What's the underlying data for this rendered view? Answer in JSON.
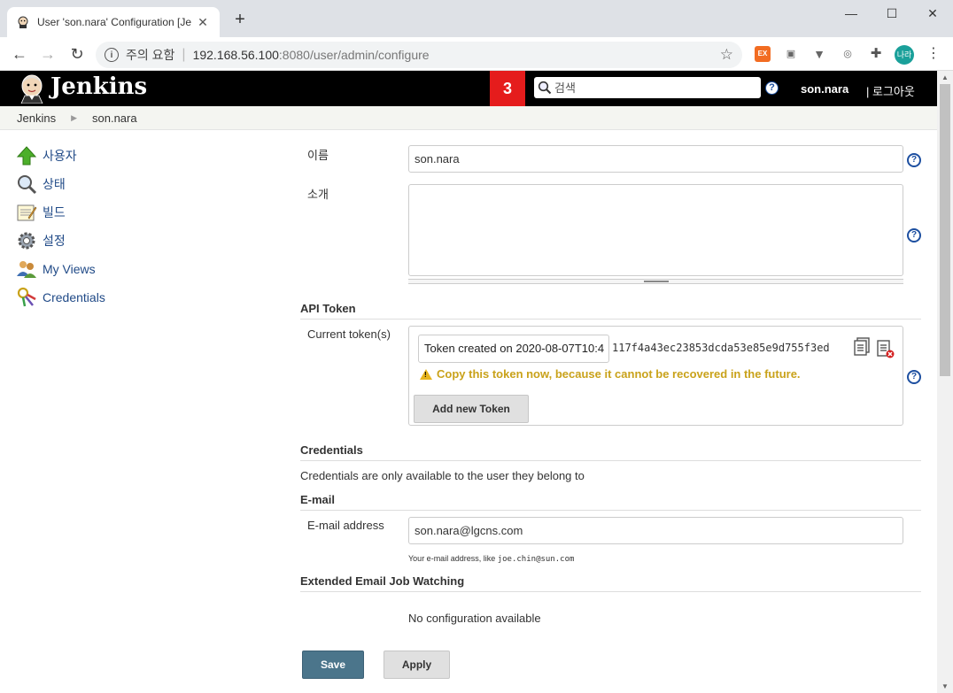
{
  "browser": {
    "tab_title": "User 'son.nara' Configuration [Je",
    "new_tab": "+",
    "url_warning": "주의 요함",
    "url_host": "192.168.56.100",
    "url_path": ":8080/user/admin/configure",
    "profile_initials": "나라",
    "ext_label": "EX"
  },
  "header": {
    "title": "Jenkins",
    "notification_count": "3",
    "search_placeholder": "검색",
    "help": "?",
    "username": "son.nara",
    "logout": "| 로그아웃"
  },
  "breadcrumb": {
    "items": [
      "Jenkins",
      "son.nara"
    ]
  },
  "sidebar": {
    "items": [
      {
        "label": "사용자",
        "icon": "up-arrow-icon"
      },
      {
        "label": "상태",
        "icon": "magnifier-icon"
      },
      {
        "label": "빌드",
        "icon": "notepad-icon"
      },
      {
        "label": "설정",
        "icon": "gear-icon"
      },
      {
        "label": "My Views",
        "icon": "people-icon"
      },
      {
        "label": "Credentials",
        "icon": "keys-icon"
      }
    ]
  },
  "form": {
    "name_label": "이름",
    "name_value": "son.nara",
    "description_label": "소개",
    "description_value": "",
    "api_token_heading": "API Token",
    "current_tokens_label": "Current token(s)",
    "token_name": "Token created on 2020-08-07T10:4",
    "token_value": "117f4a43ec23853dcda53e85e9d755f3ed",
    "token_warning": "Copy this token now, because it cannot be recovered in the future.",
    "add_token_button": "Add new Token",
    "credentials_heading": "Credentials",
    "credentials_text": "Credentials are only available to the user they belong to",
    "email_heading": "E-mail",
    "email_label": "E-mail address",
    "email_value": "son.nara@lgcns.com",
    "email_hint_prefix": "Your e-mail address, like ",
    "email_hint_example": "joe.chin@sun.com",
    "ext_email_heading": "Extended Email Job Watching",
    "no_config": "No configuration available",
    "save_button": "Save",
    "apply_button": "Apply"
  },
  "colors": {
    "header_bg": "#000000",
    "badge_red": "#e51c1c",
    "link_blue": "#204a87",
    "save_blue": "#4b758b",
    "warning_gold": "#c9a21a"
  }
}
